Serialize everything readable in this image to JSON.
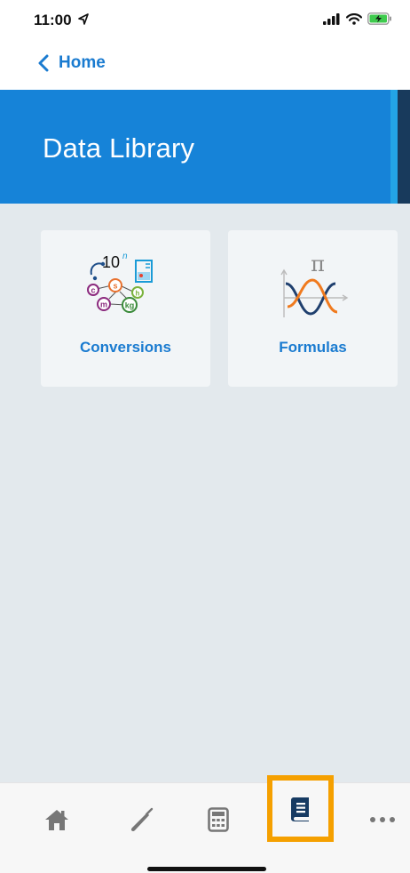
{
  "status_bar": {
    "time": "11:00",
    "icons": [
      "location-arrow-icon",
      "signal-icon",
      "wifi-icon",
      "battery-charging-icon"
    ]
  },
  "nav": {
    "back_label": "Home",
    "back_icon": "chevron-left-icon"
  },
  "header": {
    "title": "Data Library",
    "background_color": "#1683d8"
  },
  "cards": [
    {
      "label": "Conversions",
      "image": "conversions-illustration"
    },
    {
      "label": "Formulas",
      "image": "formulas-illustration"
    }
  ],
  "conversions_image_text": {
    "power": "10",
    "exponent": "n",
    "units": [
      "c",
      "s",
      "h",
      "m",
      "kg"
    ]
  },
  "formulas_image_text": {
    "symbol": "π"
  },
  "tab_bar": {
    "items": [
      {
        "name": "home",
        "icon": "home-icon"
      },
      {
        "name": "tools",
        "icon": "screwdriver-icon"
      },
      {
        "name": "calculator",
        "icon": "calculator-icon"
      },
      {
        "name": "library",
        "icon": "book-icon",
        "selected": true
      },
      {
        "name": "more",
        "icon": "more-dots-icon"
      }
    ],
    "highlight_color": "#f5a000",
    "active_color": "#173b63"
  }
}
